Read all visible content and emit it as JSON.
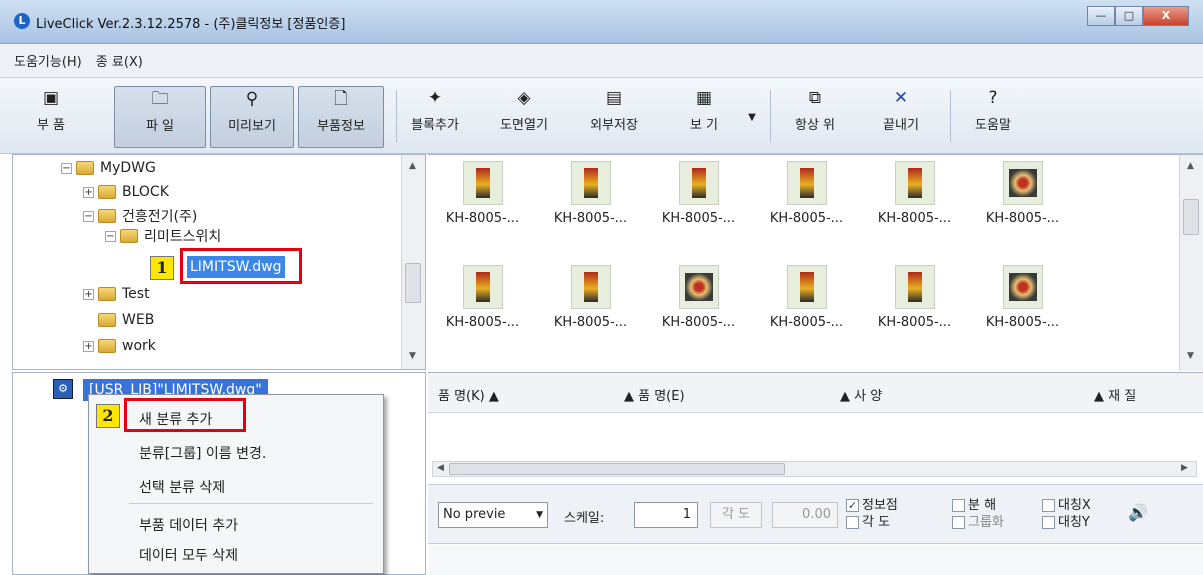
{
  "window": {
    "title": "LiveClick Ver.2.3.12.2578 - (주)클릭정보 [정품인증]",
    "buttons": {
      "minimize": "—",
      "maximize": "□",
      "close": "X"
    }
  },
  "menu": [
    "도움기능(H)",
    "종 료(X)"
  ],
  "toolbar": {
    "parts": "부 품",
    "file": "파 일",
    "preview": "미리보기",
    "part_info": "부품정보",
    "add_block": "블록추가",
    "open_drawing": "도면열기",
    "external_save": "외부저장",
    "view": "보 기",
    "always_on_top": "항상 위",
    "close": "끝내기",
    "help": "도움말"
  },
  "tree": {
    "mydwg": "MyDWG",
    "block": "BLOCK",
    "geonheung": "건흥전기(주)",
    "limit_switch": "리미트스위치",
    "selected_file": "LIMITSW.dwg",
    "test": "Test",
    "web": "WEB",
    "work": "work"
  },
  "thumbnails": [
    "KH-8005-...",
    "KH-8005-...",
    "KH-8005-...",
    "KH-8005-...",
    "KH-8005-...",
    "KH-8005-...",
    "KH-8005-...",
    "KH-8005-...",
    "KH-8005-...",
    "KH-8005-...",
    "KH-8005-...",
    "KH-8005-..."
  ],
  "callouts": {
    "one": "1",
    "two": "2"
  },
  "lower_tree": {
    "root": "[USR_LIB]\"LIMITSW.dwg\""
  },
  "context_menu": {
    "add_category": "새 분류 추가",
    "rename_group": "분류[그룹] 이름 변경.",
    "delete_category": "선택 분류 삭제",
    "add_part_data": "부품 데이터 추가",
    "delete_all": "데이터 모두 삭제"
  },
  "list_header": {
    "col1": "품 명(K) ▲",
    "col2": "▲ 품 명(E)",
    "col3": "▲ 사 양",
    "col4": "▲ 재 질"
  },
  "preview_bar": {
    "preview_select": "No previe",
    "scale_label": "스케일:",
    "scale_value": "1",
    "angle_label": "각 도",
    "angle_value": "0.00",
    "info_point": "정보점",
    "angle": "각 도",
    "explode": "분 해",
    "group": "그룹화",
    "mirror_x": "대칭X",
    "mirror_y": "대칭Y"
  },
  "colors": {
    "highlight": "#3874d8",
    "callout_box": "#e60012",
    "callout_badge": "#ffe600"
  }
}
